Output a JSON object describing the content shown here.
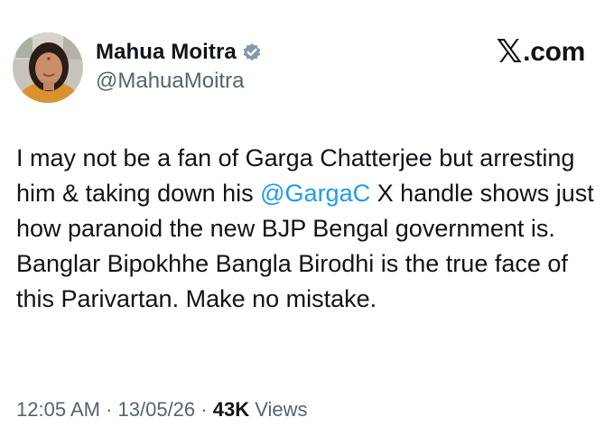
{
  "author": {
    "display_name": "Mahua Moitra",
    "handle": "@MahuaMoitra",
    "verified": true,
    "verified_badge_color": "#829aab"
  },
  "brand": {
    "logo_icon": "x-logo-icon",
    "label": ".com"
  },
  "post": {
    "text_before_mention": "I may not be a fan of Garga Chatterjee but arresting him & taking down his ",
    "mention": "@GargaC",
    "text_after_mention": " X handle shows just how paranoid the new BJP Bengal government is. Banglar Bipokhhe Bangla Birodhi is the true face of this Parivartan. Make no mistake."
  },
  "meta": {
    "time": "12:05 AM",
    "separator": " · ",
    "date": "13/05/26",
    "views_count": "43K",
    "views_label": " Views"
  },
  "colors": {
    "text": "#0f1419",
    "secondary": "#536471",
    "link": "#1d9bf0",
    "background": "#ffffff"
  }
}
